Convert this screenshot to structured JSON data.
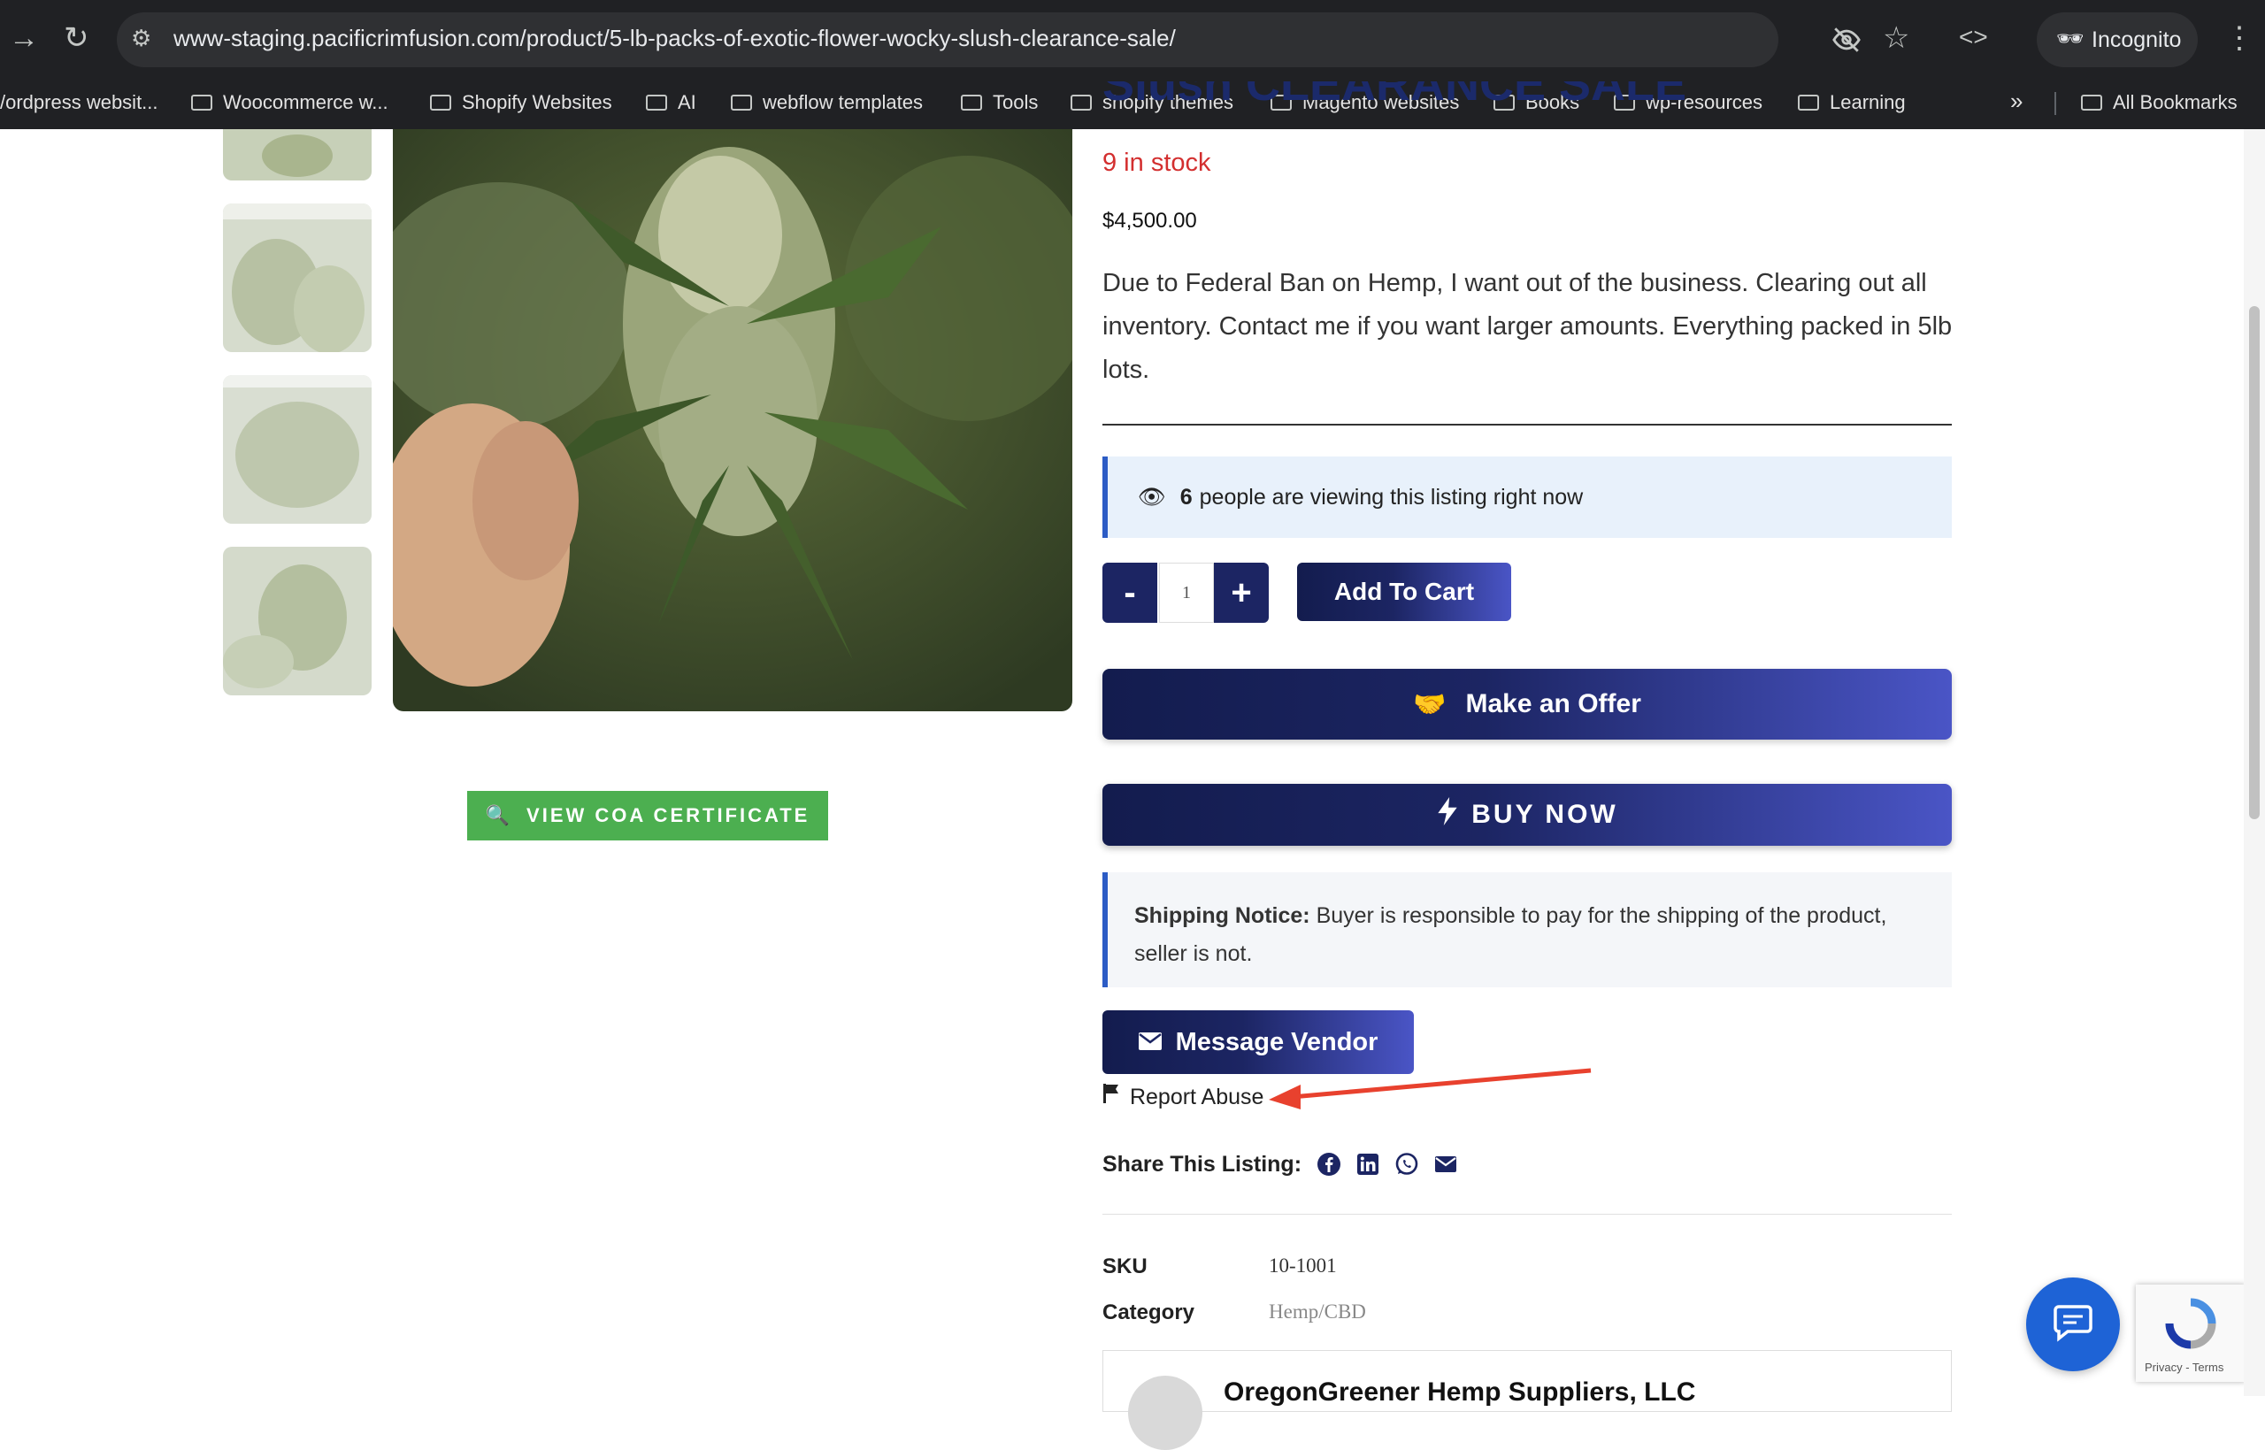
{
  "browser": {
    "url": "www-staging.pacificrimfusion.com/product/5-lb-packs-of-exotic-flower-wocky-slush-clearance-sale/",
    "profile_label": "Incognito",
    "bookmarks": [
      "/ordpress websit...",
      "Woocommerce w...",
      "Shopify Websites",
      "AI",
      "webflow templates",
      "Tools",
      "shopify themes",
      "Magento websites",
      "Books",
      "wp-resources",
      "Learning"
    ],
    "all_bookmarks": "All Bookmarks"
  },
  "product": {
    "title_fragment": "Slush CLEARANCE SALE",
    "stock": "9 in stock",
    "price": "$4,500.00",
    "description": "Due to Federal Ban on Hemp, I want out of the business. Clearing out all inventory. Contact me if you want larger amounts. Everything packed in 5lb lots.",
    "viewing_count": "6",
    "viewing_text": "people are viewing this listing right now",
    "quantity": "1",
    "minus_label": "-",
    "plus_label": "+",
    "add_to_cart": "Add To Cart",
    "make_offer": "Make an Offer",
    "buy_now": "BUY NOW",
    "shipping_label": "Shipping Notice:",
    "shipping_text": "Buyer is responsible to pay for the shipping of the product, seller is not.",
    "message_vendor": "Message Vendor",
    "report_abuse": "Report Abuse",
    "share_label": "Share This Listing:",
    "coa_button": "VIEW COA CERTIFICATE",
    "sku_label": "SKU",
    "sku_value": "10-1001",
    "category_label": "Category",
    "category_value": "Hemp/CBD",
    "vendor_name": "OregonGreener Hemp Suppliers, LLC"
  },
  "recaptcha": {
    "footer": "Privacy - Terms"
  },
  "colors": {
    "brand_navy": "#1c2563",
    "accent_blue": "#4a55c6",
    "stock_red": "#d32f2f",
    "coa_green": "#4caf50",
    "annotation_arrow": "#e8412e"
  },
  "icons": [
    "arrow-forward-icon",
    "reload-icon",
    "site-info-icon",
    "eye-off-icon",
    "star-icon",
    "code-icon",
    "incognito-icon",
    "kebab-menu-icon",
    "folder-icon",
    "chevron-double-right-icon",
    "eye-icon",
    "handshake-icon",
    "bolt-icon",
    "envelope-icon",
    "flag-icon",
    "facebook-icon",
    "linkedin-icon",
    "whatsapp-icon",
    "email-icon",
    "magnifier-icon",
    "chat-icon",
    "recaptcha-icon"
  ]
}
